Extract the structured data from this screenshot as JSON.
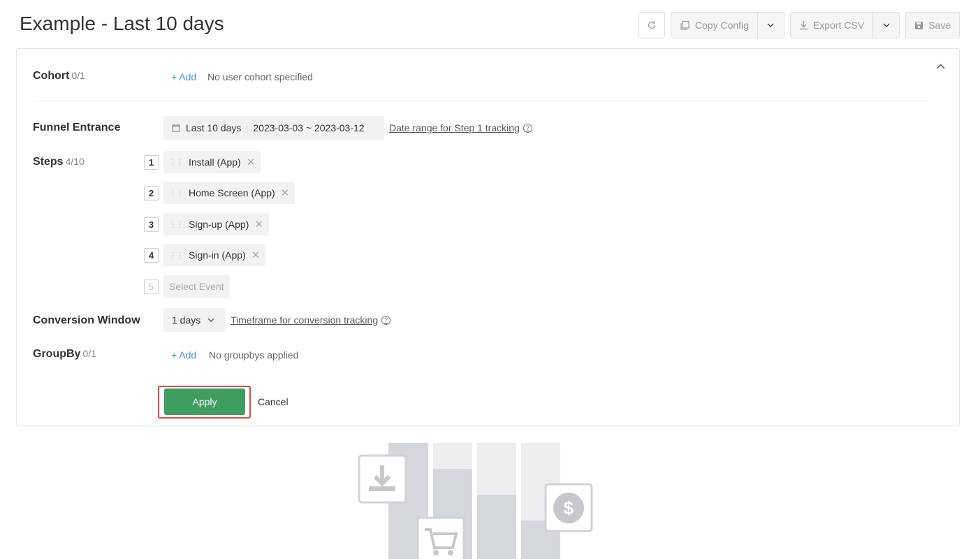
{
  "page": {
    "title": "Example - Last 10 days"
  },
  "toolbar": {
    "refresh_icon": "refresh-icon",
    "copy_label": "Copy Config",
    "export_label": "Export CSV",
    "save_label": "Save"
  },
  "cohort": {
    "label": "Cohort",
    "count": "0/1",
    "add": "+ Add",
    "empty": "No user cohort specified"
  },
  "funnel_entrance": {
    "label": "Funnel Entrance",
    "preset": "Last 10 days",
    "range": "2023-03-03 ~ 2023-03-12",
    "link": "Date range for Step 1 tracking"
  },
  "steps": {
    "label": "Steps",
    "count": "4/10",
    "items": [
      {
        "num": "1",
        "name": "Install (App)"
      },
      {
        "num": "2",
        "name": "Home Screen (App)"
      },
      {
        "num": "3",
        "name": "Sign-up (App)"
      },
      {
        "num": "4",
        "name": "Sign-in (App)"
      }
    ],
    "next_num": "5",
    "placeholder": "Select Event"
  },
  "conversion_window": {
    "label": "Conversion Window",
    "value": "1 days",
    "link": "Timeframe for conversion tracking"
  },
  "groupby": {
    "label": "GroupBy",
    "count": "0/1",
    "add": "+ Add",
    "empty": "No groupbys applied"
  },
  "actions": {
    "apply": "Apply",
    "cancel": "Cancel"
  },
  "colors": {
    "apply": "#3f9e5f",
    "highlight": "#e04848",
    "link": "#4a90e2"
  }
}
